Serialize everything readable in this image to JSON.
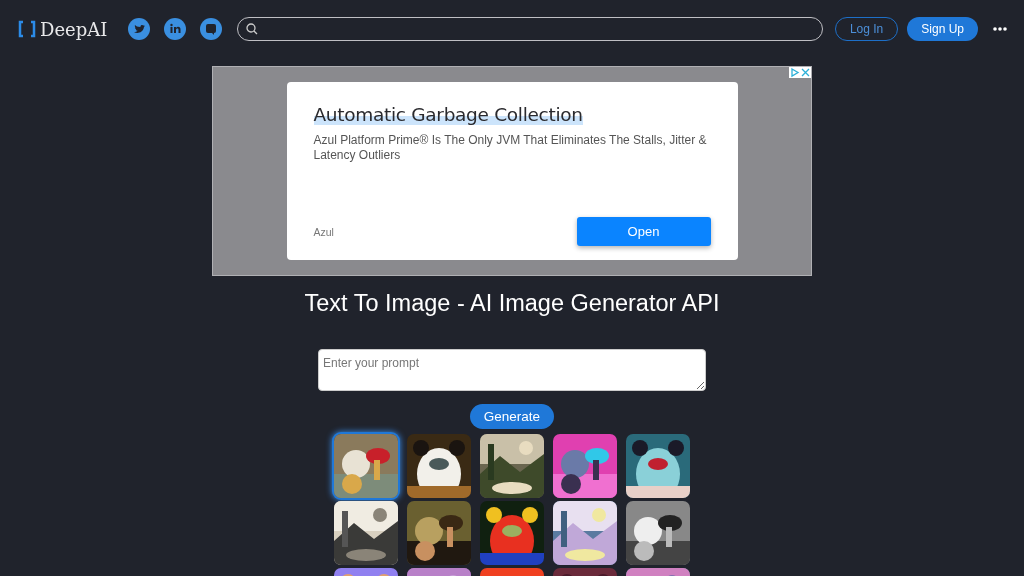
{
  "header": {
    "logo": "DeepAI",
    "login": "Log In",
    "signup": "Sign Up"
  },
  "ad": {
    "title": "Automatic Garbage Collection",
    "body": "Azul Platform Prime® Is The Only JVM That Eliminates The Stalls, Jitter & Latency Outliers",
    "advertiser": "Azul",
    "cta": "Open"
  },
  "page_title": "Text To Image - AI Image Generator API",
  "prompt": {
    "placeholder": "Enter your prompt"
  },
  "generate": "Generate",
  "styles": [
    {
      "kind": "picture",
      "selected": true
    },
    {
      "kind": "picture",
      "selected": false
    },
    {
      "kind": "picture",
      "selected": false
    },
    {
      "kind": "picture",
      "selected": false
    },
    {
      "kind": "picture",
      "selected": false
    },
    {
      "kind": "picture",
      "selected": false
    },
    {
      "kind": "picture",
      "selected": false
    },
    {
      "kind": "picture",
      "selected": false
    },
    {
      "kind": "picture",
      "selected": false
    },
    {
      "kind": "picture",
      "selected": false
    },
    {
      "kind": "picture",
      "selected": false
    },
    {
      "kind": "picture",
      "selected": false
    },
    {
      "kind": "picture",
      "selected": false
    },
    {
      "kind": "picture",
      "selected": false
    },
    {
      "kind": "picture",
      "selected": false
    }
  ]
}
